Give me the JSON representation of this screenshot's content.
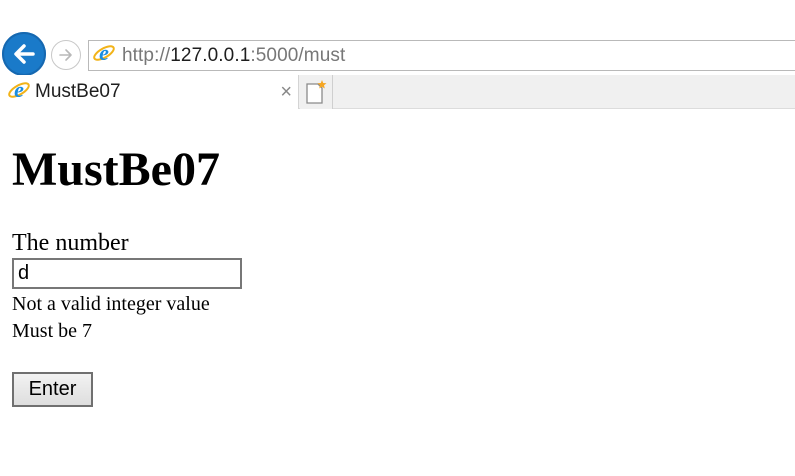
{
  "browser": {
    "url_scheme": "http://",
    "url_host": "127.0.0.1",
    "url_rest": ":5000/must",
    "tab_title": "MustBe07",
    "tab_close": "×",
    "icons": {
      "back": "back-arrow-icon",
      "forward": "forward-arrow-icon",
      "page": "internet-explorer-icon",
      "new_tab": "new-tab-icon"
    }
  },
  "page": {
    "title": "MustBe07",
    "field_label": "The number",
    "input_value": "d",
    "errors": [
      "Not a valid integer value",
      "Must be 7"
    ],
    "submit_label": "Enter"
  }
}
